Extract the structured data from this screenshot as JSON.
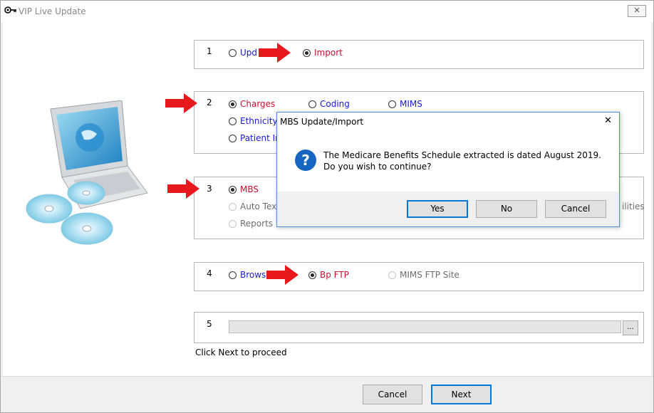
{
  "window": {
    "title": "VIP Live Update",
    "close_label": "✕"
  },
  "step1": {
    "number": "1",
    "options": [
      "Upd",
      "Import"
    ]
  },
  "step2": {
    "number": "2",
    "options": [
      "Charges",
      "Coding",
      "MIMS",
      "Ethnicity",
      "Patient Info"
    ]
  },
  "step3": {
    "number": "3",
    "options": [
      "MBS",
      "Auto Text",
      "Reports"
    ],
    "partial_right": "ilities"
  },
  "step4": {
    "number": "4",
    "options": [
      "Brows",
      "Bp FTP",
      "MIMS FTP Site"
    ]
  },
  "step5": {
    "number": "5",
    "browse_label": "..."
  },
  "hint": "Click Next to proceed",
  "buttons": {
    "cancel": "Cancel",
    "next": "Next"
  },
  "dialog": {
    "title": "MBS Update/Import",
    "close": "✕",
    "icon": "?",
    "message": "The Medicare Benefits Schedule extracted is dated  August 2019. Do you wish to continue?",
    "buttons": {
      "yes": "Yes",
      "no": "No",
      "cancel": "Cancel"
    }
  },
  "icons": {
    "title": "key-icon",
    "illustration": "laptop-globe-cd-icon",
    "arrows": "red-arrow-icon"
  },
  "colors": {
    "link_blue": "#1a1ad0",
    "selected_red": "#c8102e",
    "accent": "#0078d7",
    "arrow_red": "#e8191c"
  }
}
